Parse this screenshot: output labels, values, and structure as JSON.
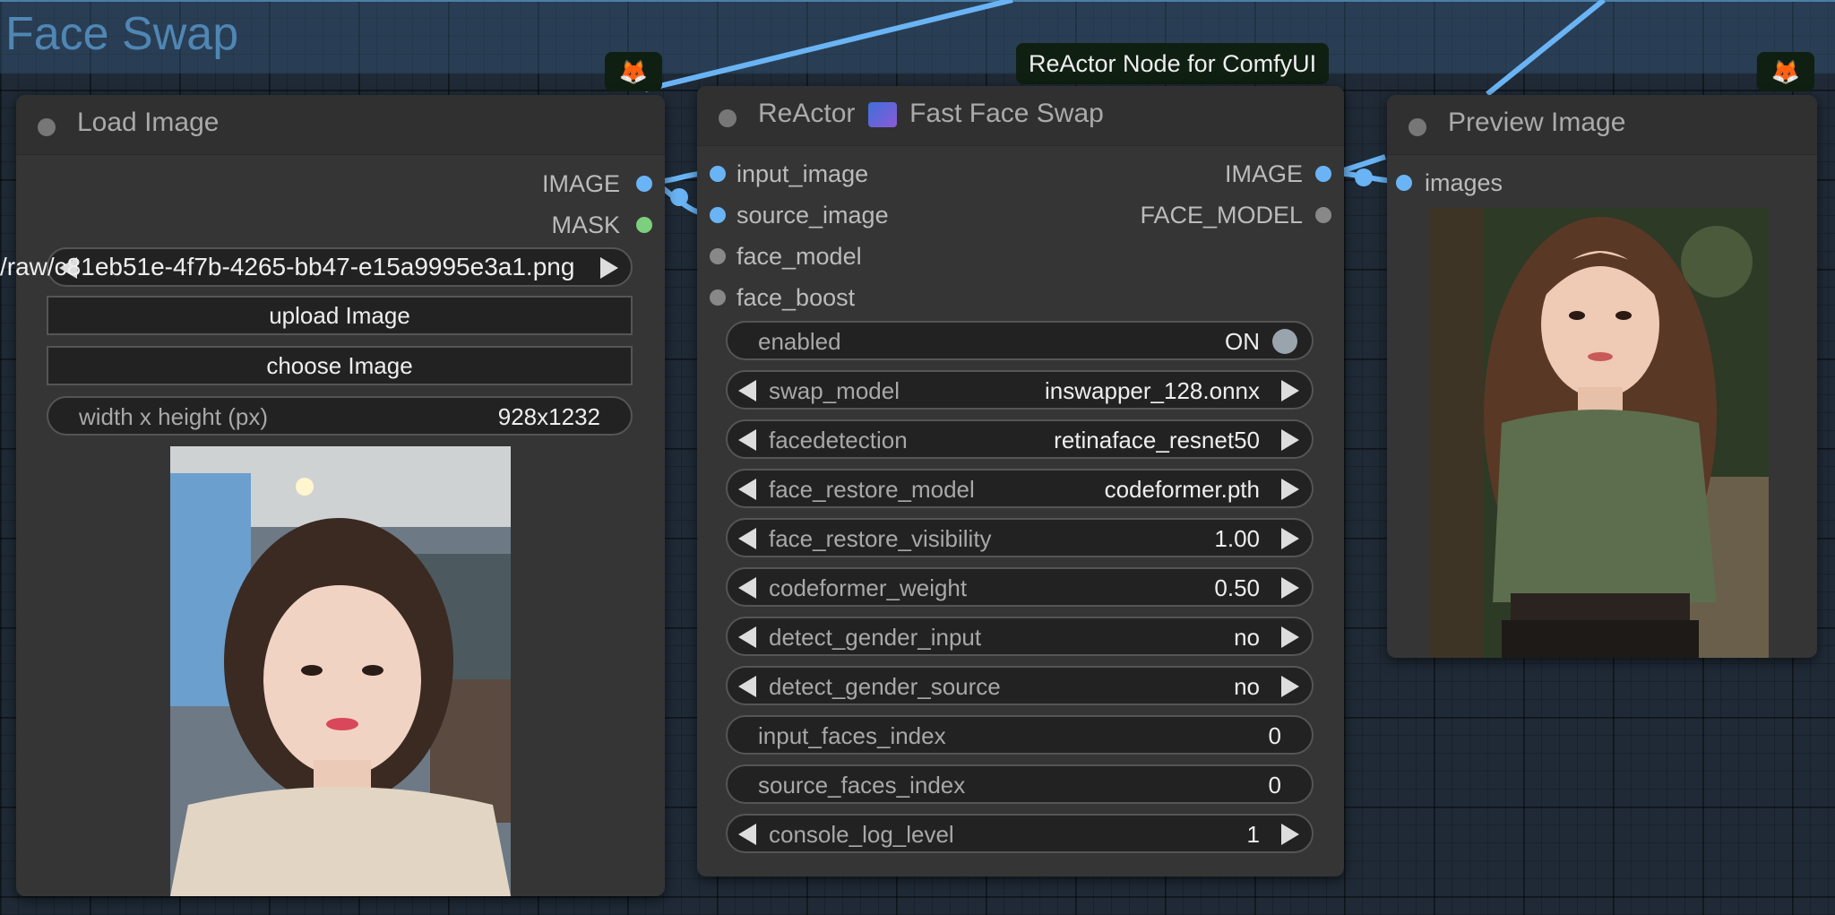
{
  "group": {
    "title": "Face Swap"
  },
  "tooltip": "ReActor Node for ComfyUI",
  "load_image": {
    "title": "Load Image",
    "outputs": [
      "IMAGE",
      "MASK"
    ],
    "image_combo_value": "/raw/c81eb51e-4f7b-4265-bb47-e15a9995e3a1.png",
    "upload_label": "upload Image",
    "choose_label": "choose Image",
    "size_label": "width x height (px)",
    "size_value": "928x1232"
  },
  "reactor": {
    "title": "ReActor 🧬 Fast Face Swap",
    "title_prefix": "ReActor",
    "title_suffix": "Fast Face Swap",
    "inputs": [
      "input_image",
      "source_image",
      "face_model",
      "face_boost"
    ],
    "outputs": [
      "IMAGE",
      "FACE_MODEL"
    ],
    "enabled": {
      "label": "enabled",
      "value": "ON"
    },
    "widgets": [
      {
        "label": "swap_model",
        "value": "inswapper_128.onnx"
      },
      {
        "label": "facedetection",
        "value": "retinaface_resnet50"
      },
      {
        "label": "face_restore_model",
        "value": "codeformer.pth"
      },
      {
        "label": "face_restore_visibility",
        "value": "1.00"
      },
      {
        "label": "codeformer_weight",
        "value": "0.50"
      },
      {
        "label": "detect_gender_input",
        "value": "no"
      },
      {
        "label": "detect_gender_source",
        "value": "no"
      },
      {
        "label": "input_faces_index",
        "value": "0"
      },
      {
        "label": "source_faces_index",
        "value": "0"
      },
      {
        "label": "console_log_level",
        "value": "1"
      }
    ]
  },
  "preview": {
    "title": "Preview Image",
    "inputs": [
      "images"
    ]
  },
  "colors": {
    "link_blue": "#6ab4f5",
    "mask_green": "#7ccf7c",
    "node_bg": "#353535",
    "canvas_bg": "#1f2a36"
  },
  "icons": [
    "fox-badge-icon",
    "dna-icon"
  ]
}
